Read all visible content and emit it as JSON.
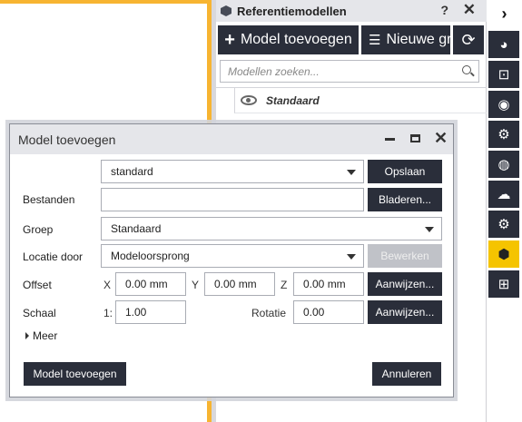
{
  "panel": {
    "title": "Referentiemodellen",
    "help": "?",
    "close": "✕",
    "add_model_label": "Model toevoegen",
    "new_group_label": "Nieuwe gr",
    "refresh_icon": "refresh-icon",
    "search_placeholder": "Modellen zoeken...",
    "groups": [
      {
        "name": "Standaard",
        "visible": true
      }
    ]
  },
  "toolbar": {
    "expand": "›",
    "items": [
      {
        "icon": "paint-palette-icon",
        "glyph": "◕",
        "active": false
      },
      {
        "icon": "selection-frame-icon",
        "glyph": "⊡",
        "active": false
      },
      {
        "icon": "eye-icon",
        "glyph": "◉",
        "active": false
      },
      {
        "icon": "gear-help-icon",
        "glyph": "⚙",
        "active": false
      },
      {
        "icon": "globe-icon",
        "glyph": "◍",
        "active": false
      },
      {
        "icon": "cloud-icon",
        "glyph": "☁",
        "active": false
      },
      {
        "icon": "settings-gear-icon",
        "glyph": "⚙",
        "active": false
      },
      {
        "icon": "reference-model-cube-icon",
        "glyph": "⬢",
        "active": true
      },
      {
        "icon": "add-component-icon",
        "glyph": "⊞",
        "active": false
      }
    ]
  },
  "dialog": {
    "title": "Model toevoegen",
    "preset_value": "standard",
    "save_label": "Opslaan",
    "files_label": "Bestanden",
    "files_value": "",
    "browse_label": "Bladeren...",
    "group_label": "Groep",
    "group_value": "Standaard",
    "location_label": "Locatie door",
    "location_value": "Modeloorsprong",
    "edit_label": "Bewerken",
    "offset_label": "Offset",
    "x_label": "X",
    "x_value": "0.00 mm",
    "y_label": "Y",
    "y_value": "0.00 mm",
    "z_label": "Z",
    "z_value": "0.00 mm",
    "pick_label": "Aanwijzen...",
    "scale_label": "Schaal",
    "scale_prefix": "1:",
    "scale_value": "1.00",
    "rotation_label": "Rotatie",
    "rotation_value": "0.00",
    "pick2_label": "Aanwijzen...",
    "more_label": "Meer",
    "add_button_label": "Model toevoegen",
    "cancel_label": "Annuleren"
  },
  "colors": {
    "accent_yellow": "#f5c400",
    "viewport_border": "#f7b431",
    "dark_button": "#2a2e3a"
  }
}
